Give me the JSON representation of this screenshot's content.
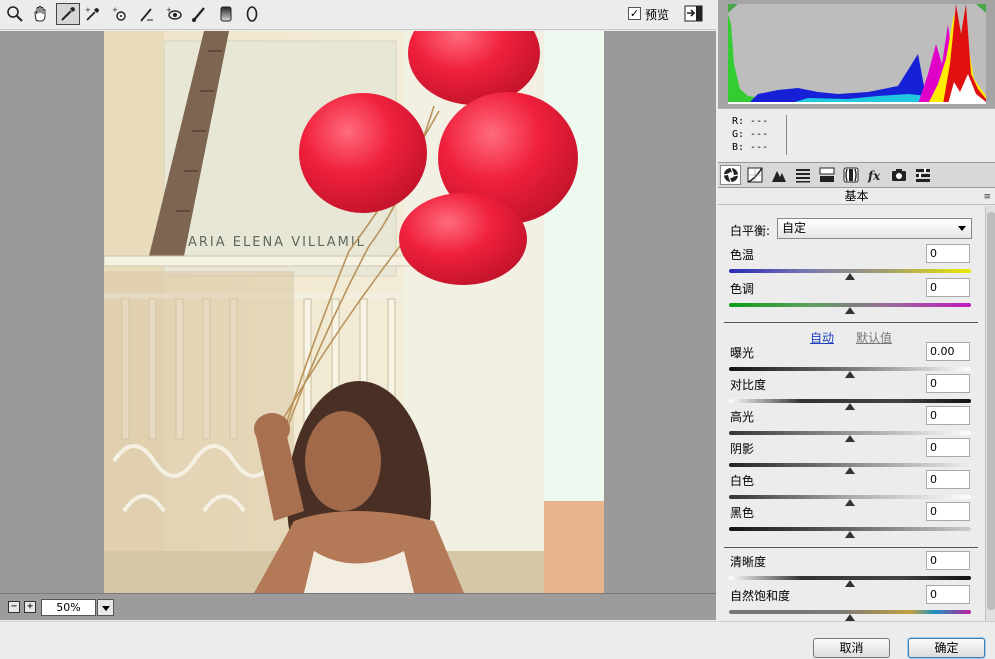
{
  "toolbar": {
    "tools": [
      {
        "name": "zoom-tool",
        "icon": "magnifier-icon",
        "active": false
      },
      {
        "name": "hand-tool",
        "icon": "hand-icon"
      },
      {
        "name": "white-balance-tool",
        "icon": "eyedropper-icon",
        "active": true
      },
      {
        "name": "color-sampler-tool",
        "icon": "sampler-icon"
      },
      {
        "name": "targeted-adjustment-tool",
        "icon": "target-adjust-icon"
      },
      {
        "name": "straighten-tool",
        "icon": "straighten-icon"
      },
      {
        "name": "red-eye-tool",
        "icon": "red-eye-icon"
      },
      {
        "name": "brush-tool",
        "icon": "brush-icon"
      },
      {
        "name": "graduated-filter-tool",
        "icon": "graduated-filter-icon"
      },
      {
        "name": "radial-filter-tool",
        "icon": "radial-filter-icon"
      }
    ],
    "preview_checked": "✓",
    "preview_label": "预览"
  },
  "photo": {
    "sign_text": "ARIA ELENA VILLAMIL"
  },
  "zoom": {
    "minus": "−",
    "plus": "+",
    "value": "50%"
  },
  "readout": {
    "r": "R:  ---",
    "g": "G:  ---",
    "b": "B:  ---"
  },
  "panel": {
    "title": "基本",
    "menu_icon": "≡",
    "white_balance": {
      "label": "白平衡:",
      "value": "自定"
    },
    "auto_label": "自动",
    "default_label": "默认值",
    "sliders": [
      {
        "label": "色温",
        "value": "0",
        "level": 0.5
      },
      {
        "label": "色调",
        "value": "0",
        "level": 0.5
      },
      {
        "label": "曝光",
        "value": "0.00",
        "level": 0.5
      },
      {
        "label": "对比度",
        "value": "0",
        "level": 0.5
      },
      {
        "label": "高光",
        "value": "0",
        "level": 0.5
      },
      {
        "label": "阴影",
        "value": "0",
        "level": 0.5
      },
      {
        "label": "白色",
        "value": "0",
        "level": 0.5
      },
      {
        "label": "黑色",
        "value": "0",
        "level": 0.5
      },
      {
        "label": "清晰度",
        "value": "0",
        "level": 0.5
      },
      {
        "label": "自然饱和度",
        "value": "0",
        "level": 0.5
      }
    ]
  },
  "buttons": {
    "cancel": "取消",
    "ok": "确定"
  },
  "colors": {
    "accent": "#1a3fbf",
    "balloon": "#f0203c",
    "canvas_bg": "#999999"
  }
}
